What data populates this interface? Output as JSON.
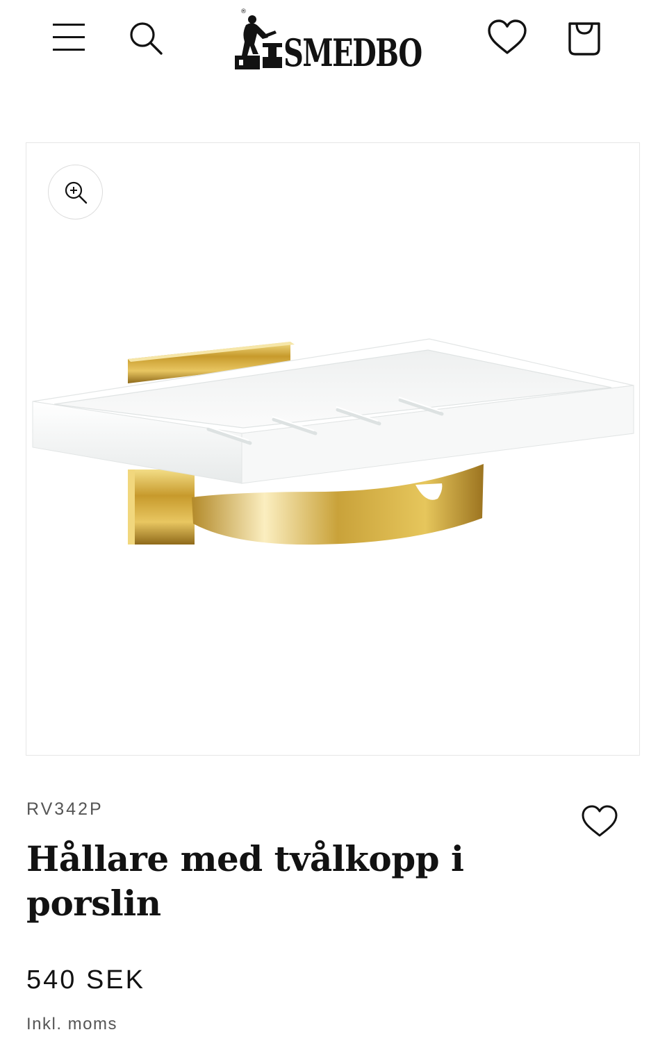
{
  "header": {
    "menu_icon": "hamburger-menu-icon",
    "search_icon": "search-icon",
    "logo_text": "SMEDBO",
    "wishlist_icon": "heart-icon",
    "cart_icon": "shopping-bag-icon"
  },
  "gallery": {
    "zoom_icon": "zoom-in-icon",
    "image_subject": "white porcelain soap dish on polished gold wall holder"
  },
  "product": {
    "sku": "RV342P",
    "title": "Hållare med tvålkopp i porslin",
    "price": "540 SEK",
    "tax_note": "Inkl. moms",
    "wishlist_icon": "heart-icon"
  },
  "colors": {
    "text": "#121212",
    "muted": "#555555",
    "gold": "#c9a23a",
    "porcelain": "#f7f8f8",
    "border": "#e6e6e6"
  }
}
